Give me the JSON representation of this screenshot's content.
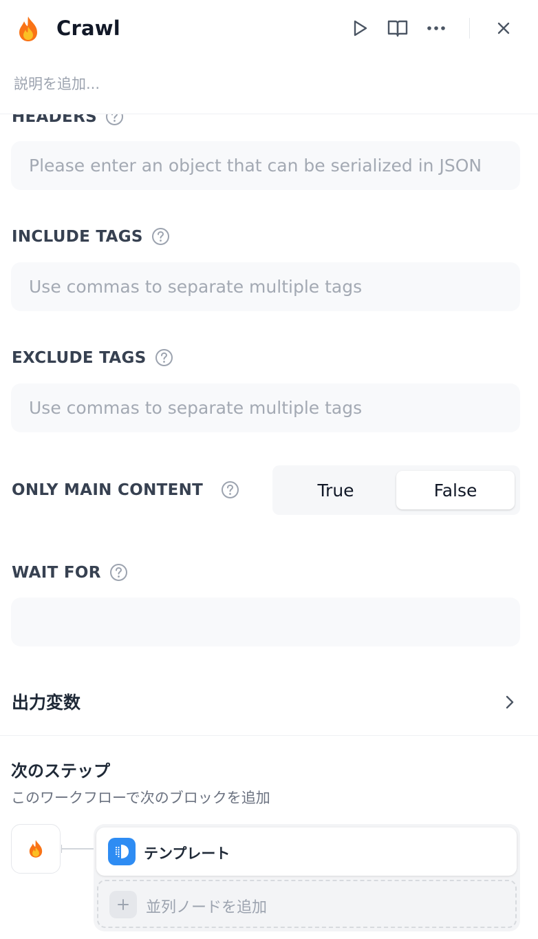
{
  "header": {
    "title": "Crawl",
    "description_placeholder": "説明を追加..."
  },
  "fields": {
    "headers": {
      "label": "HEADERS",
      "placeholder": "Please enter an object that can be serialized in JSON"
    },
    "include_tags": {
      "label": "INCLUDE TAGS",
      "placeholder": "Use commas to separate multiple tags"
    },
    "exclude_tags": {
      "label": "EXCLUDE TAGS",
      "placeholder": "Use commas to separate multiple tags"
    },
    "only_main_content": {
      "label": "ONLY MAIN CONTENT",
      "options": [
        "True",
        "False"
      ],
      "selected": "False"
    },
    "wait_for": {
      "label": "WAIT FOR",
      "value": ""
    }
  },
  "output_vars": {
    "label": "出力変数"
  },
  "next_step": {
    "title": "次のステップ",
    "description": "このワークフローで次のブロックを追加",
    "target_label": "テンプレート",
    "add_parallel_label": "並列ノードを追加"
  },
  "colors": {
    "flame_outer": "#f97316",
    "flame_inner": "#fbbf24",
    "template_icon_bg": "#2e8cf3",
    "input_bg": "#f8f9fb"
  }
}
